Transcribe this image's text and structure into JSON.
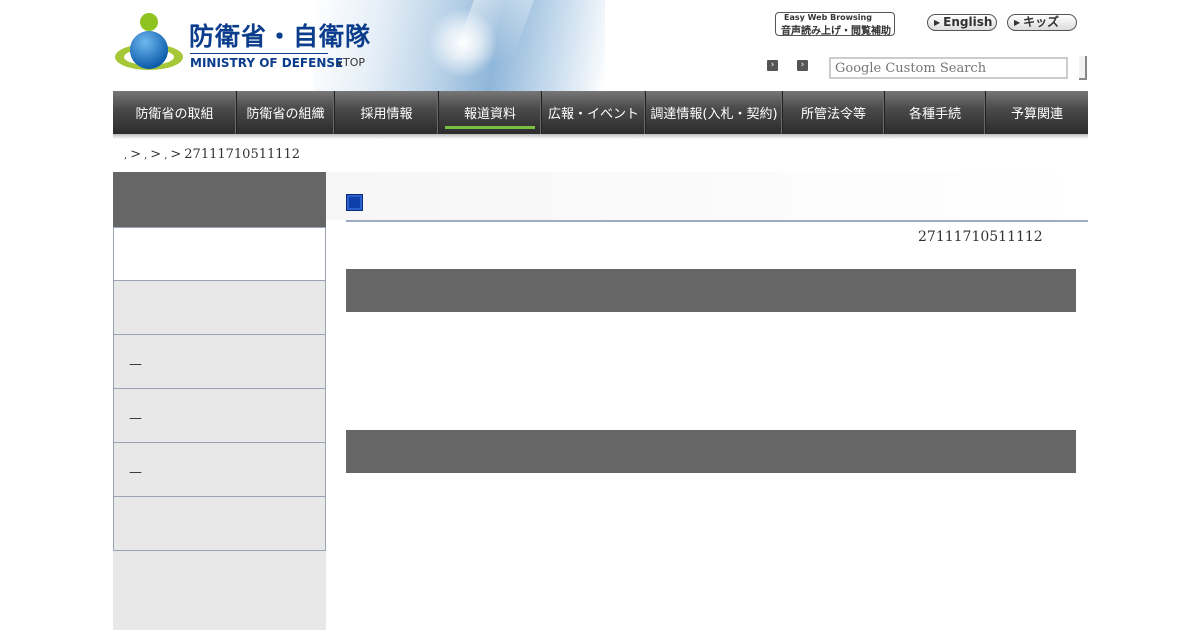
{
  "header": {
    "logo_ja": "防衛省・自衛隊",
    "logo_en": "MINISTRY OF DEFENSE",
    "top_link": "TOP",
    "easy_web_line1": "Easy Web Browsing",
    "easy_web_line2": "音声読み上げ・閲覧補助",
    "english_link": "English",
    "kids_link": "キッズ",
    "search_placeholder": "Google Custom Search"
  },
  "nav": {
    "items": [
      {
        "label": "防衛省の取組"
      },
      {
        "label": "防衛省の組織"
      },
      {
        "label": "採用情報"
      },
      {
        "label": "報道資料"
      },
      {
        "label": "広報・イベント"
      },
      {
        "label": "調達情報(入札・契約)"
      },
      {
        "label": "所管法令等"
      },
      {
        "label": "各種手続"
      },
      {
        "label": "予算関連"
      }
    ],
    "active_index": 3
  },
  "breadcrumb": {
    "crumb_1": ",",
    "crumb_2": ",",
    "crumb_3": ",",
    "separator": ">",
    "current": "27111710511112"
  },
  "sidebar": {
    "items": [
      {
        "label": ""
      },
      {
        "label": ""
      },
      {
        "label": "—"
      },
      {
        "label": "—"
      },
      {
        "label": "—"
      },
      {
        "label": ""
      }
    ]
  },
  "main": {
    "doc_number": "27111710511112"
  },
  "colors": {
    "nav_active_underline": "#7ac143",
    "title_square": "#0d3fa8",
    "section_bar": "#666666",
    "logo_text": "#0b3d8c"
  }
}
